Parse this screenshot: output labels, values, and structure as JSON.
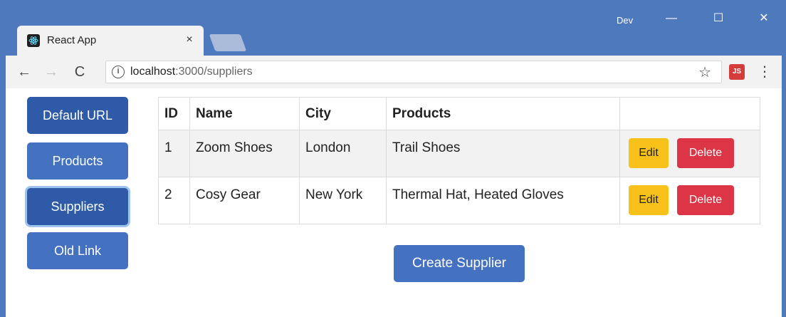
{
  "browser": {
    "tab_title": "React App",
    "tab_close": "×",
    "profile": "Dev",
    "minimize": "—",
    "maximize": "☐",
    "close": "✕",
    "url_host": "localhost",
    "url_path": ":3000/suppliers",
    "info": "i",
    "star": "☆",
    "menu": "⋮"
  },
  "nav": {
    "items": [
      {
        "label": "Default URL"
      },
      {
        "label": "Products"
      },
      {
        "label": "Suppliers"
      },
      {
        "label": "Old Link"
      }
    ]
  },
  "table": {
    "headers": [
      "ID",
      "Name",
      "City",
      "Products",
      ""
    ],
    "rows": [
      {
        "id": "1",
        "name": "Zoom Shoes",
        "city": "London",
        "products": "Trail Shoes",
        "edit": "Edit",
        "delete": "Delete"
      },
      {
        "id": "2",
        "name": "Cosy Gear",
        "city": "New York",
        "products": "Thermal Hat, Heated Gloves",
        "edit": "Edit",
        "delete": "Delete"
      }
    ]
  },
  "create_button": "Create Supplier",
  "colors": {
    "chrome": "#4f79bd",
    "primary": "#4471c0",
    "warning": "#f8c11a",
    "danger": "#dc3545"
  }
}
